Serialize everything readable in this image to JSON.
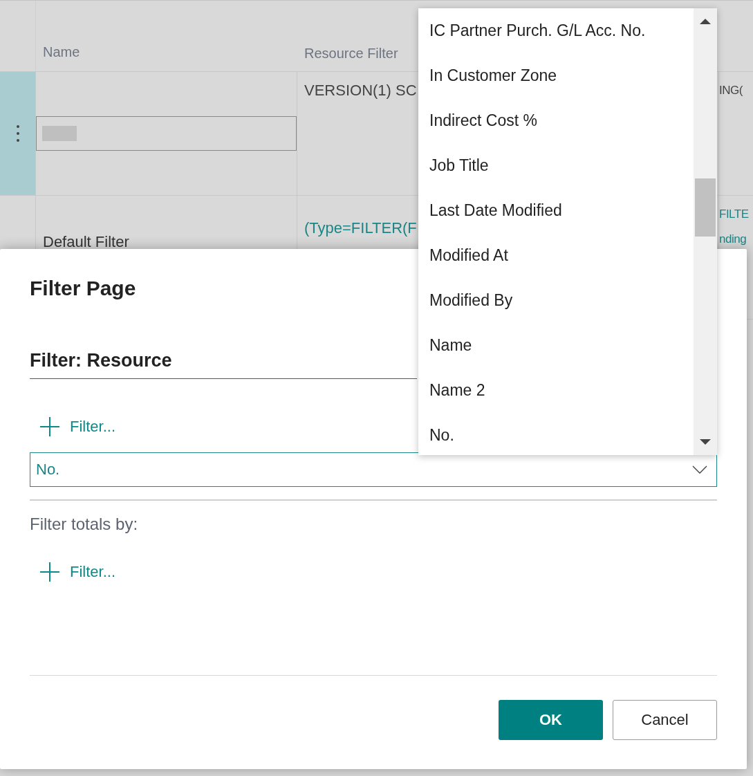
{
  "grid": {
    "columns": [
      {
        "label": "Name"
      },
      {
        "label": "Resource Filter"
      }
    ],
    "rows": [
      {
        "selected": true,
        "editing": true,
        "resource_filter": "VERSION(1) SC",
        "kind": "plain",
        "column_3": [
          "ING("
        ]
      },
      {
        "selected": false,
        "editing": false,
        "name": "Default Filter",
        "resource_filter": "(Type=FILTER(F",
        "kind": "link",
        "column_3": [
          "FILTE",
          "nding"
        ]
      }
    ]
  },
  "dialog": {
    "title": "Filter Page",
    "section": "Filter: Resource",
    "add_filter": "Filter...",
    "field": {
      "value": "No."
    },
    "totals_label": "Filter totals by:",
    "totals_add_filter": "Filter...",
    "buttons": [
      {
        "label": "OK",
        "kind": "primary"
      },
      {
        "label": "Cancel",
        "kind": "secondary"
      }
    ]
  },
  "dropdown": {
    "items": [
      "IC Partner Purch. G/L Acc. No.",
      "In Customer Zone",
      "Indirect Cost %",
      "Job Title",
      "Last Date Modified",
      "Modified At",
      "Modified By",
      "Name",
      "Name 2",
      "No."
    ]
  }
}
